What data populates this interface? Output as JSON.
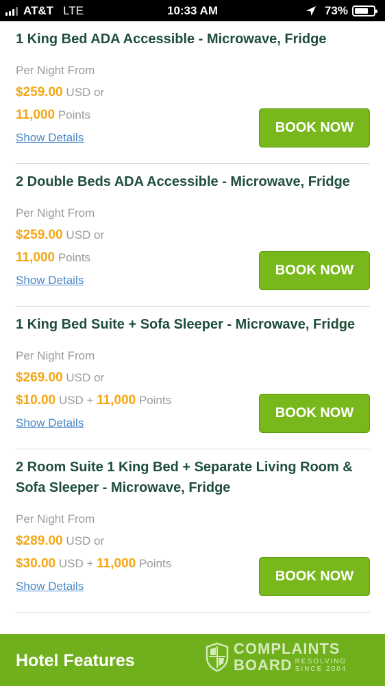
{
  "status_bar": {
    "carrier": "AT&T",
    "network": "LTE",
    "time": "10:33 AM",
    "battery": "73%",
    "battery_level": 0.73,
    "signal_bars": 3
  },
  "rooms": [
    {
      "title": "1 King Bed ADA Accessible - Microwave, Fridge",
      "per_night_label": "Per Night From",
      "price": "$259.00",
      "price_suffix": "USD or",
      "alt_cash": "",
      "alt_cash_suffix": "",
      "points": "11,000",
      "points_label": "Points",
      "details_link": "Show Details",
      "book_label": "BOOK NOW"
    },
    {
      "title": "2 Double Beds ADA Accessible - Microwave, Fridge",
      "per_night_label": "Per Night From",
      "price": "$259.00",
      "price_suffix": "USD or",
      "alt_cash": "",
      "alt_cash_suffix": "",
      "points": "11,000",
      "points_label": "Points",
      "details_link": "Show Details",
      "book_label": "BOOK NOW"
    },
    {
      "title": "1 King Bed Suite + Sofa Sleeper - Microwave, Fridge",
      "per_night_label": "Per Night From",
      "price": "$269.00",
      "price_suffix": "USD or",
      "alt_cash": "$10.00",
      "alt_cash_suffix": "USD +",
      "points": "11,000",
      "points_label": "Points",
      "details_link": "Show Details",
      "book_label": "BOOK NOW"
    },
    {
      "title": "2 Room Suite 1 King Bed + Separate Living Room & Sofa Sleeper - Microwave, Fridge",
      "per_night_label": "Per Night From",
      "price": "$289.00",
      "price_suffix": "USD or",
      "alt_cash": "$30.00",
      "alt_cash_suffix": "USD +",
      "points": "11,000",
      "points_label": "Points",
      "details_link": "Show Details",
      "book_label": "BOOK NOW"
    }
  ],
  "footer": {
    "title": "Hotel Features",
    "watermark": {
      "line1": "COMPLAINTS",
      "line2": "BOARD",
      "tag1": "RESOLVING",
      "tag2": "SINCE 2004"
    }
  },
  "colors": {
    "accent_green": "#79b81c",
    "title_green": "#1f4e3a",
    "price_gold": "#f4a715",
    "link_blue": "#4a88c7"
  }
}
